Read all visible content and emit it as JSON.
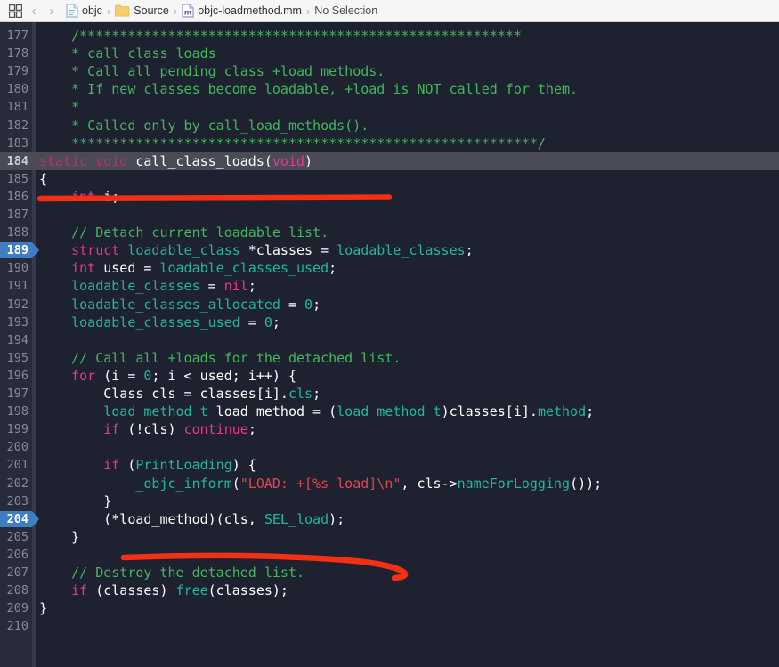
{
  "toolbar": {
    "panel_toggle_label": "",
    "back_label": "‹",
    "forward_label": "›",
    "separator": "›"
  },
  "breadcrumb": {
    "items": [
      {
        "icon": "document-icon",
        "label": "objc"
      },
      {
        "icon": "folder-icon",
        "label": "Source"
      },
      {
        "icon": "objc-file-icon",
        "label": "objc-loadmethod.mm"
      },
      {
        "icon": "none",
        "label": "No Selection"
      }
    ]
  },
  "colors": {
    "editor_background": "#1e2130",
    "gutter_background": "#282b3a",
    "current_line_highlight": "#4a4b56",
    "breakpoint_badge": "#3f7fc1",
    "annotation_red": "#f42f13",
    "comment_green": "#41b85a",
    "keyword_pink": "#e8388f",
    "type_teal": "#21b89a",
    "string_red": "#e2464a",
    "identifier_white": "#ffffff"
  },
  "editor": {
    "current_line": 184,
    "marked_lines": [
      189,
      204
    ],
    "first_visible_line": 176,
    "last_visible_line": 210,
    "lines": [
      {
        "n": 177,
        "tokens": [
          {
            "t": "    ",
            "c": "c-plain"
          },
          {
            "t": "/*******************************************************",
            "c": "c-cmt"
          }
        ]
      },
      {
        "n": 178,
        "tokens": [
          {
            "t": "    ",
            "c": "c-plain"
          },
          {
            "t": "* call_class_loads",
            "c": "c-cmt"
          }
        ]
      },
      {
        "n": 179,
        "tokens": [
          {
            "t": "    ",
            "c": "c-plain"
          },
          {
            "t": "* Call all pending class +load methods.",
            "c": "c-cmt"
          }
        ]
      },
      {
        "n": 180,
        "tokens": [
          {
            "t": "    ",
            "c": "c-plain"
          },
          {
            "t": "* If new classes become loadable, +load is NOT called for them.",
            "c": "c-cmt"
          }
        ]
      },
      {
        "n": 181,
        "tokens": [
          {
            "t": "    ",
            "c": "c-plain"
          },
          {
            "t": "*",
            "c": "c-cmt"
          }
        ]
      },
      {
        "n": 182,
        "tokens": [
          {
            "t": "    ",
            "c": "c-plain"
          },
          {
            "t": "* Called only by call_load_methods().",
            "c": "c-cmt"
          }
        ]
      },
      {
        "n": 183,
        "tokens": [
          {
            "t": "    ",
            "c": "c-plain"
          },
          {
            "t": "**********************************************************/",
            "c": "c-cmt"
          }
        ]
      },
      {
        "n": 184,
        "tokens": [
          {
            "t": "static void",
            "c": "c-kwd"
          },
          {
            "t": " call_class_loads(",
            "c": "c-id"
          },
          {
            "t": "void",
            "c": "c-kw"
          },
          {
            "t": ")",
            "c": "c-id"
          }
        ]
      },
      {
        "n": 185,
        "tokens": [
          {
            "t": "{",
            "c": "c-id"
          }
        ]
      },
      {
        "n": 186,
        "tokens": [
          {
            "t": "    ",
            "c": "c-plain"
          },
          {
            "t": "int",
            "c": "c-kw"
          },
          {
            "t": " i;",
            "c": "c-id"
          }
        ]
      },
      {
        "n": 187,
        "tokens": []
      },
      {
        "n": 188,
        "tokens": [
          {
            "t": "    ",
            "c": "c-plain"
          },
          {
            "t": "// Detach current loadable list.",
            "c": "c-cmt"
          }
        ]
      },
      {
        "n": 189,
        "tokens": [
          {
            "t": "    ",
            "c": "c-plain"
          },
          {
            "t": "struct",
            "c": "c-kw"
          },
          {
            "t": " ",
            "c": "c-id"
          },
          {
            "t": "loadable_class",
            "c": "c-type"
          },
          {
            "t": " *classes = ",
            "c": "c-id"
          },
          {
            "t": "loadable_classes",
            "c": "c-type"
          },
          {
            "t": ";",
            "c": "c-id"
          }
        ]
      },
      {
        "n": 190,
        "tokens": [
          {
            "t": "    ",
            "c": "c-plain"
          },
          {
            "t": "int",
            "c": "c-kw"
          },
          {
            "t": " used = ",
            "c": "c-id"
          },
          {
            "t": "loadable_classes_used",
            "c": "c-type"
          },
          {
            "t": ";",
            "c": "c-id"
          }
        ]
      },
      {
        "n": 191,
        "tokens": [
          {
            "t": "    ",
            "c": "c-plain"
          },
          {
            "t": "loadable_classes",
            "c": "c-type"
          },
          {
            "t": " = ",
            "c": "c-id"
          },
          {
            "t": "nil",
            "c": "c-kw"
          },
          {
            "t": ";",
            "c": "c-id"
          }
        ]
      },
      {
        "n": 192,
        "tokens": [
          {
            "t": "    ",
            "c": "c-plain"
          },
          {
            "t": "loadable_classes_allocated",
            "c": "c-type"
          },
          {
            "t": " = ",
            "c": "c-id"
          },
          {
            "t": "0",
            "c": "c-num"
          },
          {
            "t": ";",
            "c": "c-id"
          }
        ]
      },
      {
        "n": 193,
        "tokens": [
          {
            "t": "    ",
            "c": "c-plain"
          },
          {
            "t": "loadable_classes_used",
            "c": "c-type"
          },
          {
            "t": " = ",
            "c": "c-id"
          },
          {
            "t": "0",
            "c": "c-num"
          },
          {
            "t": ";",
            "c": "c-id"
          }
        ]
      },
      {
        "n": 194,
        "tokens": []
      },
      {
        "n": 195,
        "tokens": [
          {
            "t": "    ",
            "c": "c-plain"
          },
          {
            "t": "// Call all +loads for the detached list.",
            "c": "c-cmt"
          }
        ]
      },
      {
        "n": 196,
        "tokens": [
          {
            "t": "    ",
            "c": "c-plain"
          },
          {
            "t": "for",
            "c": "c-kw"
          },
          {
            "t": " (i = ",
            "c": "c-id"
          },
          {
            "t": "0",
            "c": "c-num"
          },
          {
            "t": "; i < used; i++) {",
            "c": "c-id"
          }
        ]
      },
      {
        "n": 197,
        "tokens": [
          {
            "t": "        ",
            "c": "c-plain"
          },
          {
            "t": "Class cls = classes[i].",
            "c": "c-id"
          },
          {
            "t": "cls",
            "c": "c-type"
          },
          {
            "t": ";",
            "c": "c-id"
          }
        ]
      },
      {
        "n": 198,
        "tokens": [
          {
            "t": "        ",
            "c": "c-plain"
          },
          {
            "t": "load_method_t",
            "c": "c-type"
          },
          {
            "t": " load_method = (",
            "c": "c-id"
          },
          {
            "t": "load_method_t",
            "c": "c-type"
          },
          {
            "t": ")classes[i].",
            "c": "c-id"
          },
          {
            "t": "method",
            "c": "c-type"
          },
          {
            "t": ";",
            "c": "c-id"
          }
        ]
      },
      {
        "n": 199,
        "tokens": [
          {
            "t": "        ",
            "c": "c-plain"
          },
          {
            "t": "if",
            "c": "c-kw"
          },
          {
            "t": " (!cls) ",
            "c": "c-id"
          },
          {
            "t": "continue",
            "c": "c-kw"
          },
          {
            "t": ";",
            "c": "c-id"
          }
        ]
      },
      {
        "n": 200,
        "tokens": []
      },
      {
        "n": 201,
        "tokens": [
          {
            "t": "        ",
            "c": "c-plain"
          },
          {
            "t": "if",
            "c": "c-kw"
          },
          {
            "t": " (",
            "c": "c-id"
          },
          {
            "t": "PrintLoading",
            "c": "c-type"
          },
          {
            "t": ") {",
            "c": "c-id"
          }
        ]
      },
      {
        "n": 202,
        "tokens": [
          {
            "t": "            ",
            "c": "c-plain"
          },
          {
            "t": "_objc_inform",
            "c": "c-type"
          },
          {
            "t": "(",
            "c": "c-id"
          },
          {
            "t": "\"LOAD: +[%s load]\\n\"",
            "c": "c-str"
          },
          {
            "t": ", cls->",
            "c": "c-id"
          },
          {
            "t": "nameForLogging",
            "c": "c-fn"
          },
          {
            "t": "());",
            "c": "c-id"
          }
        ]
      },
      {
        "n": 203,
        "tokens": [
          {
            "t": "        ",
            "c": "c-plain"
          },
          {
            "t": "}",
            "c": "c-id"
          }
        ]
      },
      {
        "n": 204,
        "tokens": [
          {
            "t": "        ",
            "c": "c-plain"
          },
          {
            "t": "(*load_method)(cls, ",
            "c": "c-id"
          },
          {
            "t": "SEL_load",
            "c": "c-type"
          },
          {
            "t": ");",
            "c": "c-id"
          }
        ]
      },
      {
        "n": 205,
        "tokens": [
          {
            "t": "    ",
            "c": "c-plain"
          },
          {
            "t": "}",
            "c": "c-id"
          }
        ]
      },
      {
        "n": 206,
        "tokens": []
      },
      {
        "n": 207,
        "tokens": [
          {
            "t": "    ",
            "c": "c-plain"
          },
          {
            "t": "// Destroy the detached list.",
            "c": "c-cmt"
          }
        ]
      },
      {
        "n": 208,
        "tokens": [
          {
            "t": "    ",
            "c": "c-plain"
          },
          {
            "t": "if",
            "c": "c-kw"
          },
          {
            "t": " (classes) ",
            "c": "c-id"
          },
          {
            "t": "free",
            "c": "c-fn"
          },
          {
            "t": "(classes);",
            "c": "c-id"
          }
        ]
      },
      {
        "n": 209,
        "tokens": [
          {
            "t": "}",
            "c": "c-id"
          }
        ]
      },
      {
        "n": 210,
        "tokens": []
      }
    ]
  },
  "annotations": [
    {
      "name": "red-underline-line-185",
      "type": "straight-line"
    },
    {
      "name": "red-squiggle-line-204",
      "type": "curved-line"
    }
  ]
}
